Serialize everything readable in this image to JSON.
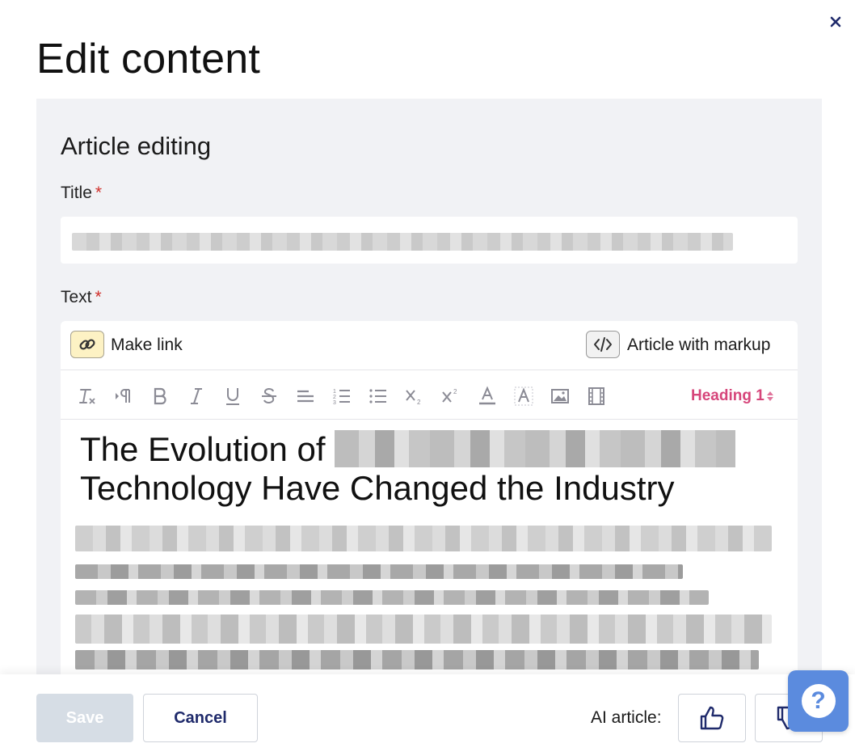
{
  "dialog": {
    "title": "Edit content",
    "close_icon": "close-icon"
  },
  "form": {
    "section_title": "Article editing",
    "title_label": "Title",
    "text_label": "Text",
    "required_mark": "*"
  },
  "editor": {
    "make_link_label": "Make link",
    "markup_label": "Article with markup",
    "heading_select": "Heading 1",
    "heading_text": "The Evolution of",
    "heading_text_line2": "Technology Have Changed the Industry",
    "toolbar_icons": [
      "clear-format-icon",
      "paragraph-direction-icon",
      "bold-icon",
      "italic-icon",
      "underline-icon",
      "strikethrough-icon",
      "align-icon",
      "ordered-list-icon",
      "bullet-list-icon",
      "subscript-icon",
      "superscript-icon",
      "text-color-icon",
      "highlight-icon",
      "image-icon",
      "video-icon"
    ]
  },
  "footer": {
    "save_label": "Save",
    "cancel_label": "Cancel",
    "ai_label": "AI article:"
  },
  "help": {
    "label": "?"
  },
  "colors": {
    "accent_navy": "#1f2a6b",
    "heading_pink": "#d6457a",
    "help_blue": "#5b8bde",
    "panel_bg": "#f1f2f5",
    "link_btn_bg": "#fdf2c4"
  }
}
